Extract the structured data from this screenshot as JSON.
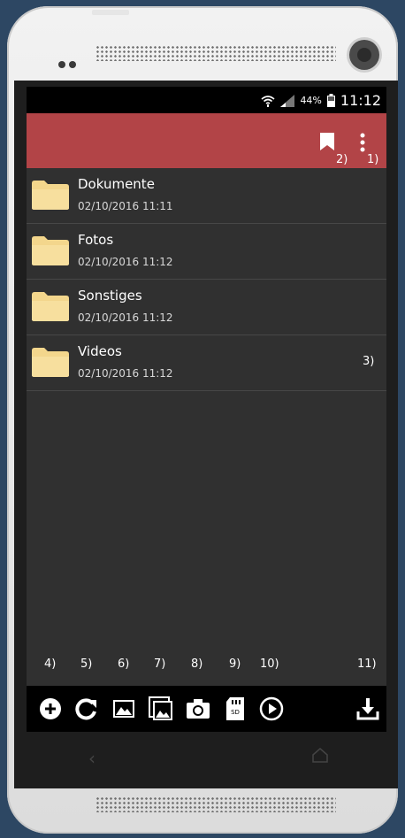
{
  "status": {
    "battery": "44%",
    "time": "11:12"
  },
  "annotations": {
    "bookmark": "2)",
    "overflow": "1)",
    "row": "3)"
  },
  "items": [
    {
      "name": "Dokumente",
      "date": "02/10/2016 11:11"
    },
    {
      "name": "Fotos",
      "date": "02/10/2016 11:12"
    },
    {
      "name": "Sonstiges",
      "date": "02/10/2016 11:12"
    },
    {
      "name": "Videos",
      "date": "02/10/2016 11:12"
    }
  ],
  "toolbar_annotations": [
    "4)",
    "5)",
    "6)",
    "7)",
    "8)",
    "9)",
    "10)",
    "11)"
  ],
  "toolbar_icons": [
    "add-icon",
    "refresh-icon",
    "image-icon",
    "gallery-icon",
    "camera-icon",
    "sd-card-icon",
    "play-icon",
    "download-icon"
  ],
  "colors": {
    "appbar": "#b24447",
    "background": "#303030",
    "folder": "#f3d68c"
  }
}
